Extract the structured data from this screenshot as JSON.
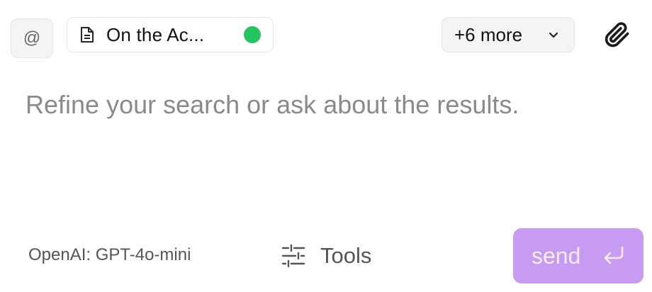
{
  "toolbar": {
    "mention_symbol": "@",
    "attachment_chip": {
      "label": "On the Ac...",
      "icon": "document-icon",
      "status_color": "#22c55e"
    },
    "more_label": "+6 more",
    "more_icon": "chevron-down-icon",
    "attach_icon": "paperclip-icon"
  },
  "prompt": {
    "value": "",
    "placeholder": "Refine your search or ask about the results."
  },
  "footer": {
    "model_label": "OpenAI: GPT-4o-mini",
    "tools_label": "Tools",
    "tools_icon": "sliders-icon",
    "send_label": "send",
    "send_icon": "enter-icon"
  },
  "colors": {
    "send_button": "#c79bf2",
    "status_dot": "#22c55e",
    "placeholder": "#8a8a8a"
  }
}
